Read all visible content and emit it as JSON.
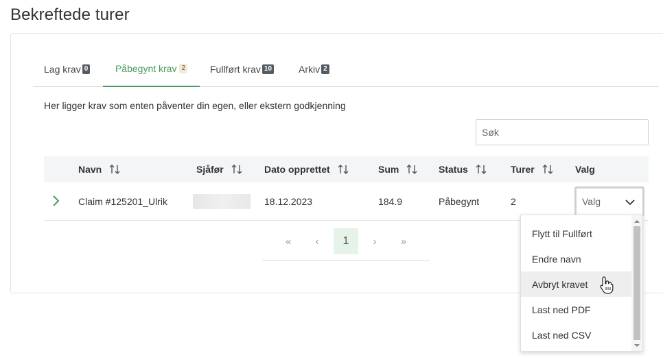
{
  "page": {
    "title": "Bekreftede turer"
  },
  "tabs": [
    {
      "label": "Lag krav",
      "count": "0",
      "active": false
    },
    {
      "label": "Påbegynt krav",
      "count": "2",
      "active": true
    },
    {
      "label": "Fullført krav",
      "count": "10",
      "active": false
    },
    {
      "label": "Arkiv",
      "count": "2",
      "active": false
    }
  ],
  "description": "Her ligger krav som enten påventer din egen, eller ekstern godkjenning",
  "search": {
    "placeholder": "Søk",
    "value": ""
  },
  "table": {
    "columns": [
      "Navn",
      "Sjåfør",
      "Dato opprettet",
      "Sum",
      "Status",
      "Turer",
      "Valg"
    ],
    "rows": [
      {
        "navn": "Claim #125201_Ulrik",
        "sjafor": "",
        "dato": "18.12.2023",
        "sum": "184.9",
        "status": "Påbegynt",
        "turer": "2",
        "valg": "Valg"
      }
    ]
  },
  "pagination": {
    "first": "«",
    "prev": "‹",
    "current": "1",
    "next": "›",
    "last": "»"
  },
  "dropdown": {
    "items": [
      "Flytt til Fullført",
      "Endre navn",
      "Avbryt kravet",
      "Last ned PDF",
      "Last ned CSV"
    ],
    "hovered": "Avbryt kravet"
  },
  "colors": {
    "accent": "#4a9b5f",
    "badge": "#555b63",
    "active_page_bg": "#e6f3e9"
  },
  "icons": [
    "sort-icon",
    "chevron-right-icon",
    "chevron-down-icon",
    "hand-cursor-icon"
  ]
}
